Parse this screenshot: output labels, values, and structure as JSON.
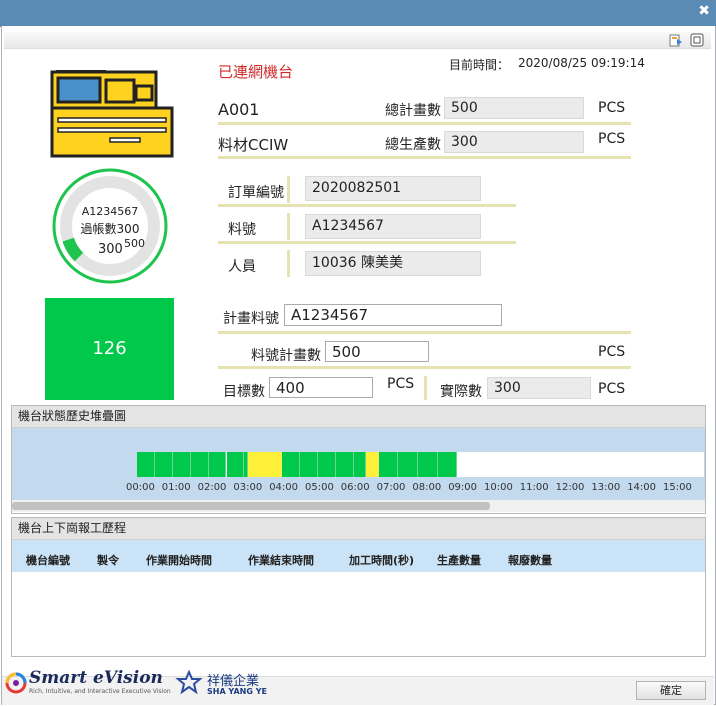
{
  "status_title": "已連網機台",
  "current_time_label": "目前時間：",
  "current_time": "2020/08/25 09:19:14",
  "machine_id": "A001",
  "material": "料材CCIW",
  "total_plan_label": "總計畫數",
  "total_plan": "500",
  "total_output_label": "總生產數",
  "total_output": "300",
  "pcs": "PCS",
  "order_no_label": "訂單編號",
  "order_no": "2020082501",
  "part_no_label": "料號",
  "part_no": "A1234567",
  "person_label": "人員",
  "person": "10036  陳美美",
  "gauge": {
    "part": "A1234567",
    "line2": "過帳數300",
    "current": "300",
    "target": "500",
    "progress_fraction": 0.1
  },
  "green_box_value": "126",
  "plan_part_label": "計畫料號",
  "plan_part": "A1234567",
  "part_plan_qty_label": "料號計畫數",
  "part_plan_qty": "500",
  "target_label": "目標數",
  "target_qty": "400",
  "actual_label": "實際數",
  "actual_qty": "300",
  "history_title": "機台狀態歷史堆疊圖",
  "timeline_ticks": [
    "00:00",
    "01:00",
    "02:00",
    "03:00",
    "04:00",
    "05:00",
    "06:00",
    "07:00",
    "08:00",
    "09:00",
    "10:00",
    "11:00",
    "12:00",
    "13:00",
    "14:00",
    "15:00"
  ],
  "timeline_colors": {
    "running": "#00c84a",
    "idle": "#fff03a"
  },
  "report_title": "機台上下崗報工歷程",
  "report_columns": [
    "機台編號",
    "製令",
    "作業開始時間",
    "作業結束時間",
    "加工時間(秒)",
    "生產數量",
    "報廢數量"
  ],
  "brand_name": "Smart eVision",
  "brand_tagline": "Rich, Intuitive, and Interactive Executive Vision",
  "company_name": "祥儀企業",
  "company_en": "SHA YANG YE",
  "confirm_button": "確定"
}
